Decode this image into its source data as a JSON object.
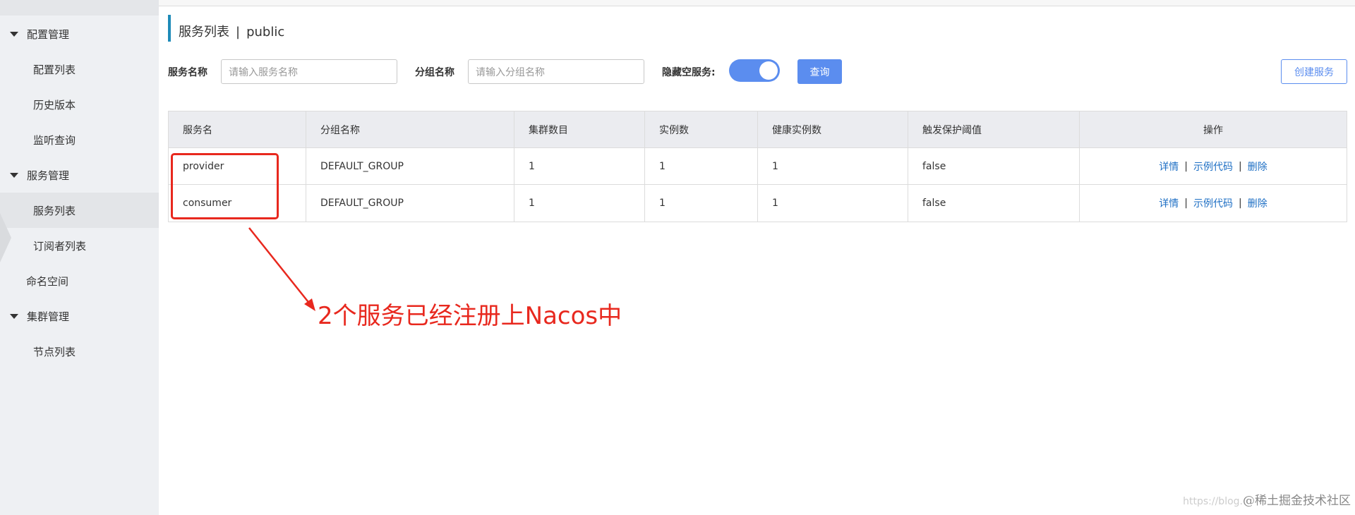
{
  "sidebar": {
    "groups": [
      {
        "label": "配置管理",
        "items": [
          "配置列表",
          "历史版本",
          "监听查询"
        ]
      },
      {
        "label": "服务管理",
        "items": [
          "服务列表",
          "订阅者列表"
        ]
      },
      {
        "label": "命名空间"
      },
      {
        "label": "集群管理",
        "items": [
          "节点列表"
        ]
      }
    ]
  },
  "header": {
    "title": "服务列表",
    "separator": "|",
    "namespace": "public"
  },
  "filters": {
    "service_name_label": "服务名称",
    "service_name_placeholder": "请输入服务名称",
    "group_name_label": "分组名称",
    "group_name_placeholder": "请输入分组名称",
    "hide_empty_label": "隐藏空服务:",
    "hide_empty_on": true,
    "query_label": "查询",
    "create_label": "创建服务"
  },
  "table": {
    "columns": [
      "服务名",
      "分组名称",
      "集群数目",
      "实例数",
      "健康实例数",
      "触发保护阈值",
      "操作"
    ],
    "rows": [
      [
        "provider",
        "DEFAULT_GROUP",
        "1",
        "1",
        "1",
        "false"
      ],
      [
        "consumer",
        "DEFAULT_GROUP",
        "1",
        "1",
        "1",
        "false"
      ]
    ],
    "actions": [
      "详情",
      "示例代码",
      "删除"
    ],
    "action_sep": "|"
  },
  "annotation": {
    "text": "2个服务已经注册上Nacos中",
    "color": "#e8281e"
  },
  "watermark": {
    "faint": "https://blog.",
    "text": "@稀土掘金技术社区"
  },
  "colors": {
    "accent": "#5b8def",
    "link": "#1e6fc4",
    "title_bar": "#1e8bb8"
  }
}
